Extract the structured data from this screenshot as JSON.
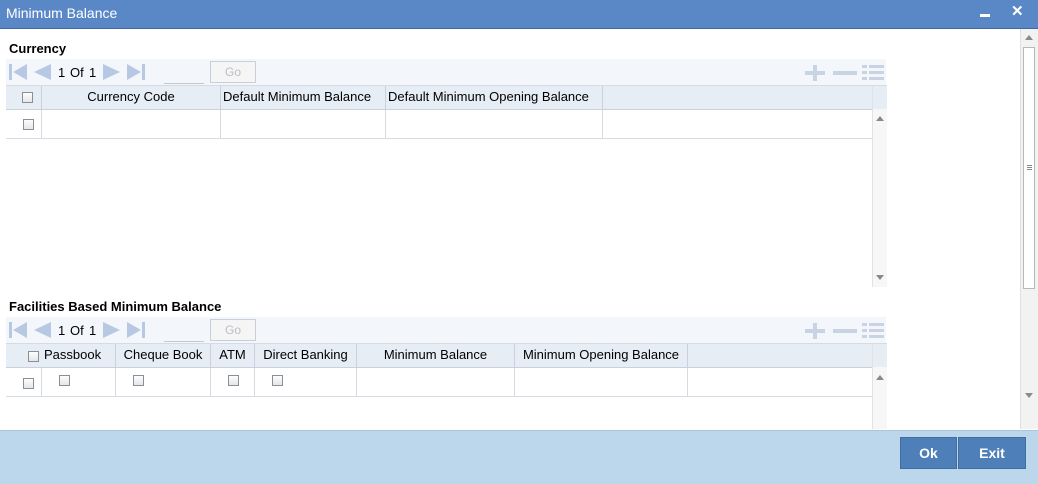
{
  "window": {
    "title": "Minimum Balance",
    "minimize_icon": "minimize-icon",
    "close_icon": "close-icon",
    "close_glyph": "✕"
  },
  "currency": {
    "section_title": "Currency",
    "pager": {
      "current": "1",
      "of_label": "Of",
      "total": "1",
      "go_label": "Go"
    },
    "columns": [
      "Currency Code",
      "Default Minimum Balance",
      "Default Minimum Opening Balance"
    ]
  },
  "facilities": {
    "section_title": "Facilities Based Minimum Balance",
    "pager": {
      "current": "1",
      "of_label": "Of",
      "total": "1",
      "go_label": "Go"
    },
    "columns": [
      "Passbook",
      "Cheque Book",
      "ATM",
      "Direct Banking",
      "Minimum Balance",
      "Minimum Opening Balance"
    ]
  },
  "footer": {
    "ok_label": "Ok",
    "exit_label": "Exit"
  },
  "colors": {
    "titlebar": "#5a88c6",
    "footer": "#bcd6ec",
    "button": "#4e7fb8",
    "header_row": "#e7edf5"
  }
}
